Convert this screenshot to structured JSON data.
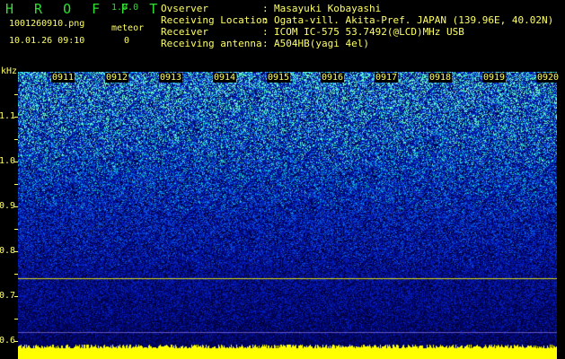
{
  "header": {
    "app_name": "H R O F F T",
    "version": "1.0.0",
    "filename": "1001260910.png",
    "timestamp": "10.01.26 09:10",
    "meteor_label": "meteor",
    "meteor_count": "0"
  },
  "info": [
    {
      "label": "Ovserver",
      "sep": ":",
      "value": "Masayuki Kobayashi"
    },
    {
      "label": "Receiving Location",
      "sep": ":",
      "value": "Ogata-vill. Akita-Pref. JAPAN (139.96E, 40.02N)"
    },
    {
      "label": "Receiver",
      "sep": ":",
      "value": "ICOM IC-575 53.7492(@LCD)MHz USB"
    },
    {
      "label": "Receiving antenna",
      "sep": ":",
      "value": "A504HB(yagi 4el)"
    }
  ],
  "axis": {
    "y_unit": "kHz",
    "y_ticks": [
      "1.1",
      "1.0",
      "0.9",
      "0.8",
      "0.7",
      "0.6"
    ],
    "x_ticks": [
      "0911",
      "0912",
      "0913",
      "0914",
      "0915",
      "0916",
      "0917",
      "0918",
      "0919",
      "0920"
    ]
  },
  "colors": {
    "text": "#ffff66",
    "logo": "#33dd33",
    "background": "#000000",
    "noise_floor": "#ffff00"
  }
}
